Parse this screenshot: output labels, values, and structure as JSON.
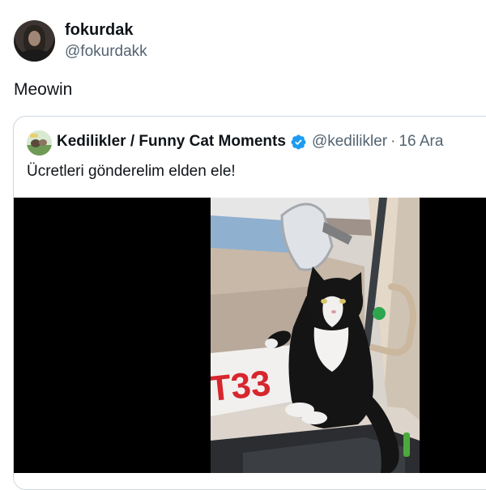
{
  "tweet": {
    "author_name": "fokurdak",
    "author_handle": "@fokurdakk",
    "text": "Meowin"
  },
  "quote": {
    "author_name": "Kedilikler / Funny Cat Moments",
    "author_handle": "@kedilikler",
    "separator": "·",
    "date": "16 Ara",
    "text": "Ücretleri gönderelim elden ele!",
    "video_sign_text": "T33",
    "verified_color": "#1d9bf0"
  },
  "icons": {
    "verified": "verified-badge-icon"
  }
}
